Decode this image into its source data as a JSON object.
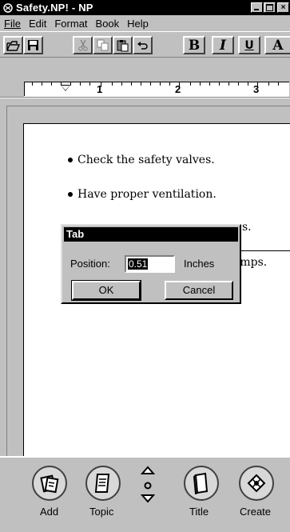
{
  "window": {
    "title": "Safety.NP! - NP",
    "controls": [
      "minimize",
      "maximize",
      "close"
    ]
  },
  "menu": {
    "items": [
      {
        "label": "File"
      },
      {
        "label": "Edit"
      },
      {
        "label": "Format"
      },
      {
        "label": "Book"
      },
      {
        "label": "Help"
      }
    ]
  },
  "toolbar": {
    "buttons": [
      "open-icon",
      "save-icon",
      "cut-icon",
      "copy-icon",
      "paste-icon",
      "undo-icon",
      "bold",
      "italic",
      "underline",
      "font"
    ],
    "bold_label": "B",
    "italic_label": "I",
    "underline_label": "U",
    "font_label": "A"
  },
  "ruler": {
    "numbers": [
      "1",
      "2",
      "3"
    ]
  },
  "document": {
    "lines": [
      "Check the safety valves.",
      "Have proper ventilation.",
      "s.",
      "amps."
    ]
  },
  "dialog": {
    "title": "Tab",
    "position_label": "Position:",
    "position_value": "0.51",
    "unit_label": "Inches",
    "ok_label": "OK",
    "cancel_label": "Cancel"
  },
  "bottom": {
    "add_label": "Add",
    "topic_label": "Topic",
    "title_label": "Title",
    "create_label": "Create"
  }
}
